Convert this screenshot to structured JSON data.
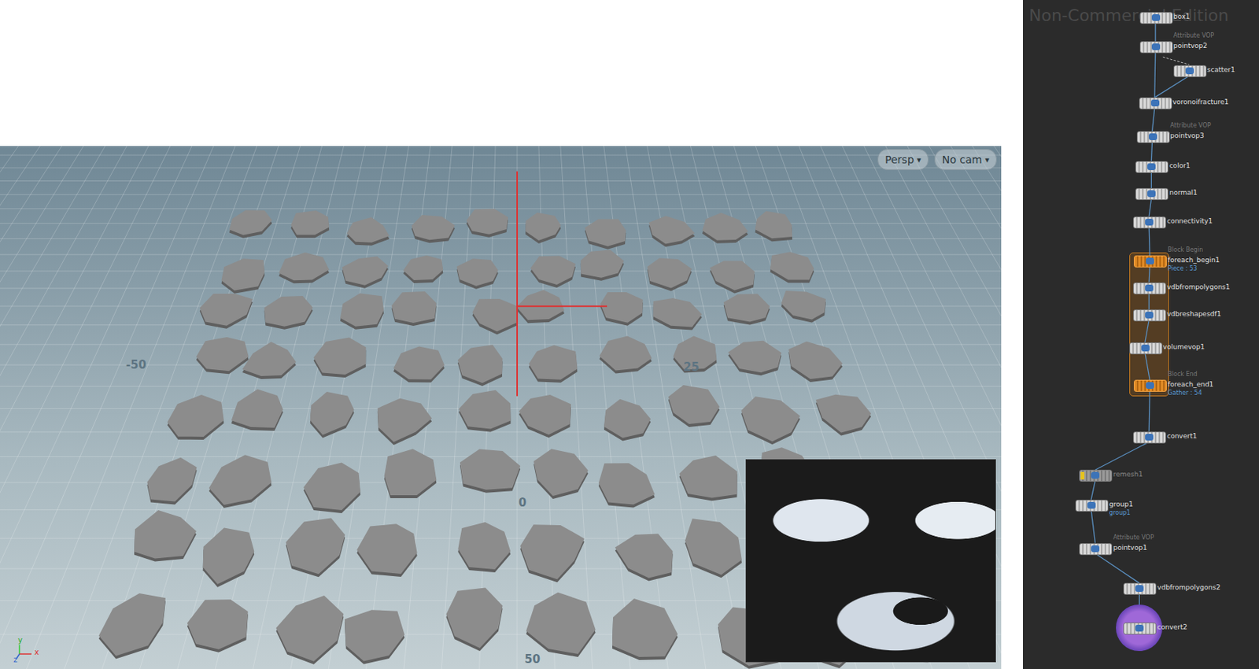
{
  "viewport": {
    "camera_menus": [
      {
        "label": "Persp",
        "icon": "▾"
      },
      {
        "label": "No cam",
        "icon": "▾"
      }
    ],
    "axis_labels": [
      "-50",
      "25",
      "0",
      "50"
    ],
    "gizmo": [
      "y",
      "x",
      "z"
    ]
  },
  "network": {
    "watermark": "Non-Commercial Edition",
    "nodes": [
      {
        "name": "box1",
        "type_label": "",
        "note": "",
        "kind": "sop",
        "bypassed": false,
        "display": false
      },
      {
        "name": "pointvop2",
        "type_label": "Attribute VOP",
        "note": "",
        "kind": "sop",
        "bypassed": false,
        "display": false
      },
      {
        "name": "scatter1",
        "type_label": "",
        "note": "",
        "kind": "sop",
        "bypassed": false,
        "display": false
      },
      {
        "name": "voronoifracture1",
        "type_label": "",
        "note": "",
        "kind": "sop",
        "bypassed": false,
        "display": false
      },
      {
        "name": "pointvop3",
        "type_label": "Attribute VOP",
        "note": "",
        "kind": "sop",
        "bypassed": false,
        "display": false
      },
      {
        "name": "color1",
        "type_label": "",
        "note": "",
        "kind": "sop",
        "bypassed": false,
        "display": false
      },
      {
        "name": "normal1",
        "type_label": "",
        "note": "",
        "kind": "sop",
        "bypassed": false,
        "display": false
      },
      {
        "name": "connectivity1",
        "type_label": "",
        "note": "",
        "kind": "sop",
        "bypassed": false,
        "display": false
      },
      {
        "name": "foreach_begin1",
        "type_label": "Block Begin",
        "note": "Piece : 53",
        "kind": "block",
        "bypassed": false,
        "display": false
      },
      {
        "name": "vdbfrompolygons1",
        "type_label": "",
        "note": "",
        "kind": "sop",
        "bypassed": false,
        "display": false
      },
      {
        "name": "vdbreshapesdf1",
        "type_label": "",
        "note": "",
        "kind": "sop",
        "bypassed": false,
        "display": false
      },
      {
        "name": "volumevop1",
        "type_label": "",
        "note": "",
        "kind": "sop",
        "bypassed": false,
        "display": false
      },
      {
        "name": "foreach_end1",
        "type_label": "Block End",
        "note": "Gather : 54",
        "kind": "block",
        "bypassed": false,
        "display": false
      },
      {
        "name": "convert1",
        "type_label": "",
        "note": "",
        "kind": "sop",
        "bypassed": false,
        "display": false
      },
      {
        "name": "remesh1",
        "type_label": "",
        "note": "",
        "kind": "sop",
        "bypassed": true,
        "display": false
      },
      {
        "name": "group1",
        "type_label": "",
        "note": "group1",
        "kind": "sop",
        "bypassed": false,
        "display": false
      },
      {
        "name": "pointvop1",
        "type_label": "Attribute VOP",
        "note": "",
        "kind": "sop",
        "bypassed": false,
        "display": false
      },
      {
        "name": "vdbfrompolygons2",
        "type_label": "",
        "note": "",
        "kind": "sop",
        "bypassed": false,
        "display": false
      },
      {
        "name": "convert2",
        "type_label": "",
        "note": "",
        "kind": "sop",
        "bypassed": false,
        "display": true
      }
    ]
  }
}
